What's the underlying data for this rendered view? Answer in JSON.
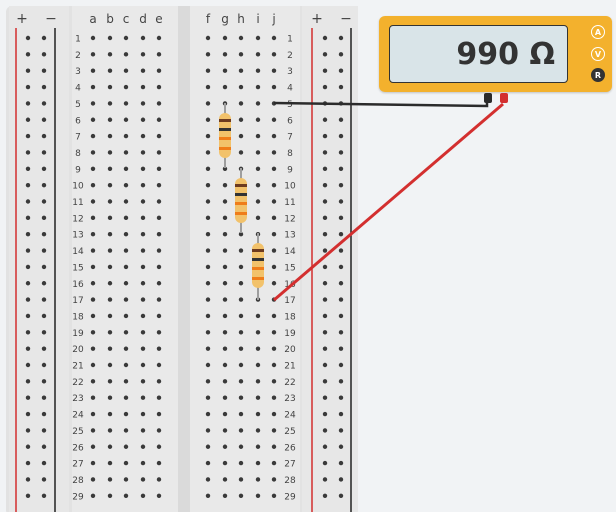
{
  "breadboard": {
    "rail_plus": "+",
    "rail_minus": "−",
    "cols_left": [
      "a",
      "b",
      "c",
      "d",
      "e"
    ],
    "cols_right": [
      "f",
      "g",
      "h",
      "i",
      "j"
    ],
    "rows": [
      "1",
      "2",
      "3",
      "4",
      "5",
      "6",
      "7",
      "8",
      "9",
      "10",
      "11",
      "12",
      "13",
      "14",
      "15",
      "16",
      "17",
      "18",
      "19",
      "20",
      "21",
      "22",
      "23",
      "24",
      "25",
      "26",
      "27",
      "28",
      "29"
    ]
  },
  "multimeter": {
    "reading": "990 Ω",
    "modes": [
      {
        "label": "A",
        "active": false
      },
      {
        "label": "V",
        "active": false
      },
      {
        "label": "R",
        "active": true
      }
    ],
    "colors": {
      "body": "#f3b12d",
      "display": "#d9e4e8"
    }
  },
  "wires": {
    "colors": {
      "black": "#2b2b2b",
      "red": "#d32f2f"
    }
  },
  "components": {
    "resistor_count_label": "",
    "resistor_color": "#f2c26b"
  }
}
